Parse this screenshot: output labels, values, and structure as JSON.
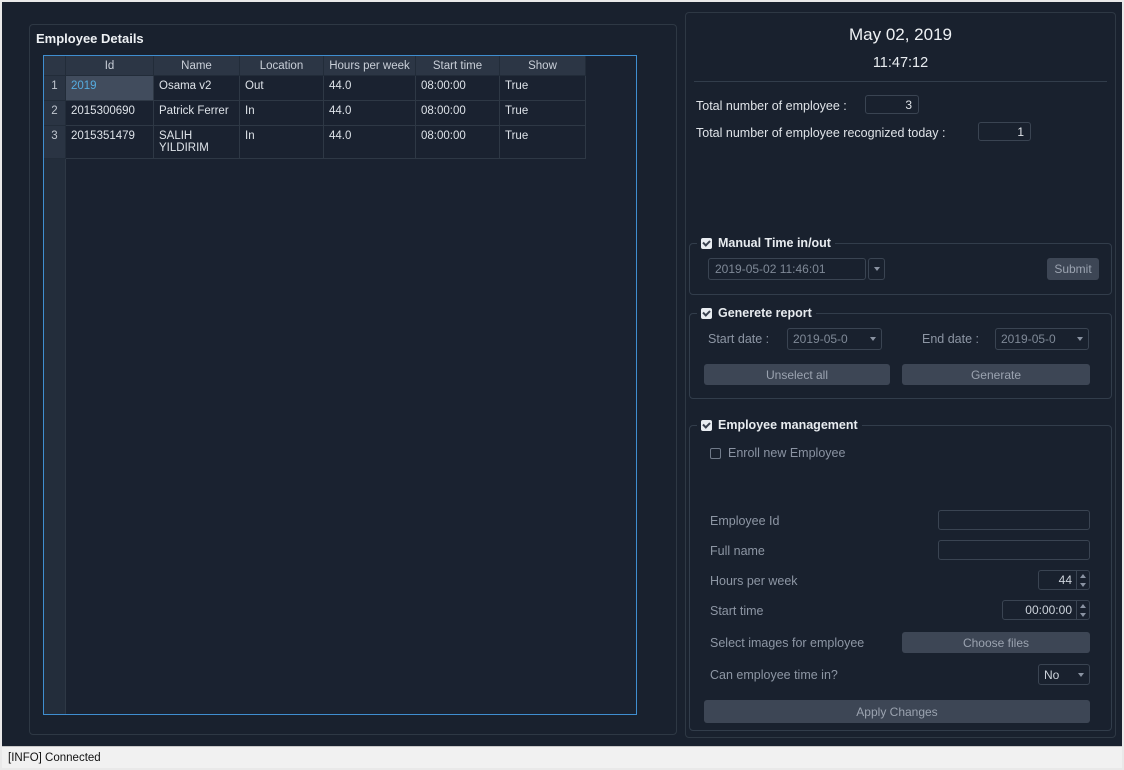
{
  "status_bar": {
    "text": "[INFO] Connected"
  },
  "colors": {
    "background": "#19212e",
    "table_focus_border": "#3f8ed0",
    "selected_cell_bg": "#414c5d",
    "selected_cell_text": "#55ace0",
    "button_bg": "#3d4655",
    "disabled_text": "#8a93a2"
  },
  "left_panel": {
    "title": "Employee Details",
    "table": {
      "columns": [
        "Id",
        "Name",
        "Location",
        "Hours per week",
        "Start time",
        "Show"
      ],
      "rows": [
        {
          "num": "1",
          "id": "2019",
          "name": "Osama v2",
          "location": "Out",
          "hours_per_week": "44.0",
          "start_time": "08:00:00",
          "show": "True"
        },
        {
          "num": "2",
          "id": "2015300690",
          "name": "Patrick Ferrer",
          "location": "In",
          "hours_per_week": "44.0",
          "start_time": "08:00:00",
          "show": "True"
        },
        {
          "num": "3",
          "id": "2015351479",
          "name": "SALIH YILDIRIM",
          "location": "In",
          "hours_per_week": "44.0",
          "start_time": "08:00:00",
          "show": "True"
        }
      ]
    }
  },
  "right_panel": {
    "date": "May 02, 2019",
    "time": "11:47:12",
    "totals": {
      "total_label": "Total number of employee :",
      "total_value": "3",
      "recognized_label": "Total number of employee recognized today :",
      "recognized_value": "1"
    },
    "manual_time": {
      "title": "Manual Time in/out",
      "datetime_value": "2019-05-02 11:46:01",
      "submit_label": "Submit"
    },
    "generate_report": {
      "title": "Generete report",
      "start_date_label": "Start date :",
      "start_date_value": "2019-05-0",
      "end_date_label": "End date :",
      "end_date_value": "2019-05-0",
      "unselect_all_label": "Unselect all",
      "generate_label": "Generate"
    },
    "employee_management": {
      "title": "Employee management",
      "enroll_label": "Enroll new Employee",
      "employee_id_label": "Employee Id",
      "employee_id_value": "",
      "full_name_label": "Full name",
      "full_name_value": "",
      "hours_per_week_label": "Hours per week",
      "hours_per_week_value": "44",
      "start_time_label": "Start time",
      "start_time_value": "00:00:00",
      "images_label": "Select images for employee",
      "choose_files_label": "Choose files",
      "can_time_in_label": "Can employee time in?",
      "can_time_in_value": "No",
      "apply_changes_label": "Apply Changes"
    }
  }
}
